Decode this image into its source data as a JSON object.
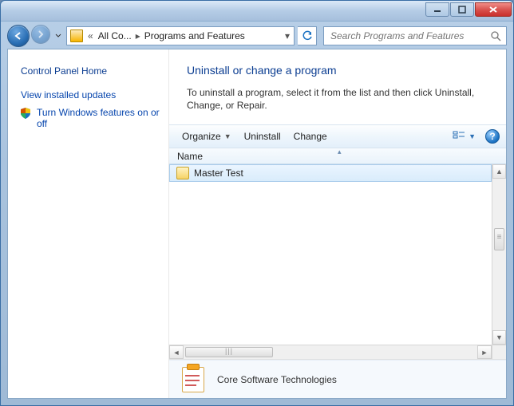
{
  "breadcrumb": {
    "level1": "All Co...",
    "level2": "Programs and Features"
  },
  "search": {
    "placeholder": "Search Programs and Features"
  },
  "sidebar": {
    "home": "Control Panel Home",
    "links": [
      {
        "label": "View installed updates"
      },
      {
        "label": "Turn Windows features on or off"
      }
    ]
  },
  "main": {
    "title": "Uninstall or change a program",
    "description": "To uninstall a program, select it from the list and then click Uninstall, Change, or Repair."
  },
  "cmdbar": {
    "organize": "Organize",
    "uninstall": "Uninstall",
    "change": "Change"
  },
  "columns": {
    "name": "Name"
  },
  "items": [
    {
      "name": "Master Test"
    }
  ],
  "details": {
    "publisher": "Core Software Technologies"
  }
}
